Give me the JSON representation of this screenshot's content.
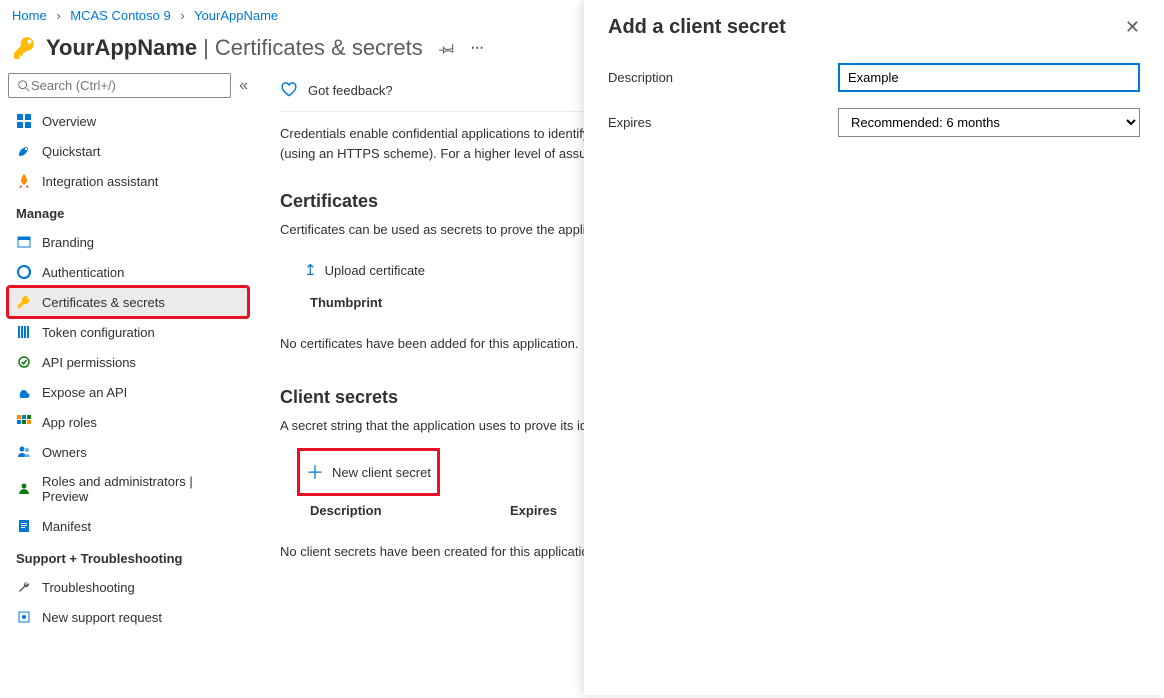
{
  "breadcrumb": {
    "items": [
      "Home",
      "MCAS Contoso 9",
      "YourAppName"
    ]
  },
  "header": {
    "title": "YourAppName",
    "subtitle": "Certificates & secrets"
  },
  "search": {
    "placeholder": "Search (Ctrl+/)"
  },
  "sidebar": {
    "items": [
      {
        "label": "Overview"
      },
      {
        "label": "Quickstart"
      },
      {
        "label": "Integration assistant"
      }
    ],
    "sections": [
      {
        "title": "Manage",
        "items": [
          {
            "label": "Branding"
          },
          {
            "label": "Authentication"
          },
          {
            "label": "Certificates & secrets"
          },
          {
            "label": "Token configuration"
          },
          {
            "label": "API permissions"
          },
          {
            "label": "Expose an API"
          },
          {
            "label": "App roles"
          },
          {
            "label": "Owners"
          },
          {
            "label": "Roles and administrators | Preview"
          },
          {
            "label": "Manifest"
          }
        ]
      },
      {
        "title": "Support + Troubleshooting",
        "items": [
          {
            "label": "Troubleshooting"
          },
          {
            "label": "New support request"
          }
        ]
      }
    ]
  },
  "content": {
    "feedback": "Got feedback?",
    "intro": "Credentials enable confidential applications to identify themselves to the authentication service when receiving tokens at a web addressable location (using an HTTPS scheme). For a higher level of assurance, we recommend using a certificate (instead of a client secret) as a credential.",
    "certificates": {
      "title": "Certificates",
      "desc": "Certificates can be used as secrets to prove the application's identity when requesting a token. Also can be referred to as public keys.",
      "upload": "Upload certificate",
      "col1": "Thumbprint",
      "empty": "No certificates have been added for this application."
    },
    "secrets": {
      "title": "Client secrets",
      "desc": "A secret string that the application uses to prove its identity when requesting a token. Also can be referred to as application password.",
      "new": "New client secret",
      "col1": "Description",
      "col2": "Expires",
      "empty": "No client secrets have been created for this application."
    }
  },
  "flyout": {
    "title": "Add a client secret",
    "fields": {
      "description_label": "Description",
      "description_value": "Example",
      "expires_label": "Expires",
      "expires_value": "Recommended: 6 months"
    }
  }
}
